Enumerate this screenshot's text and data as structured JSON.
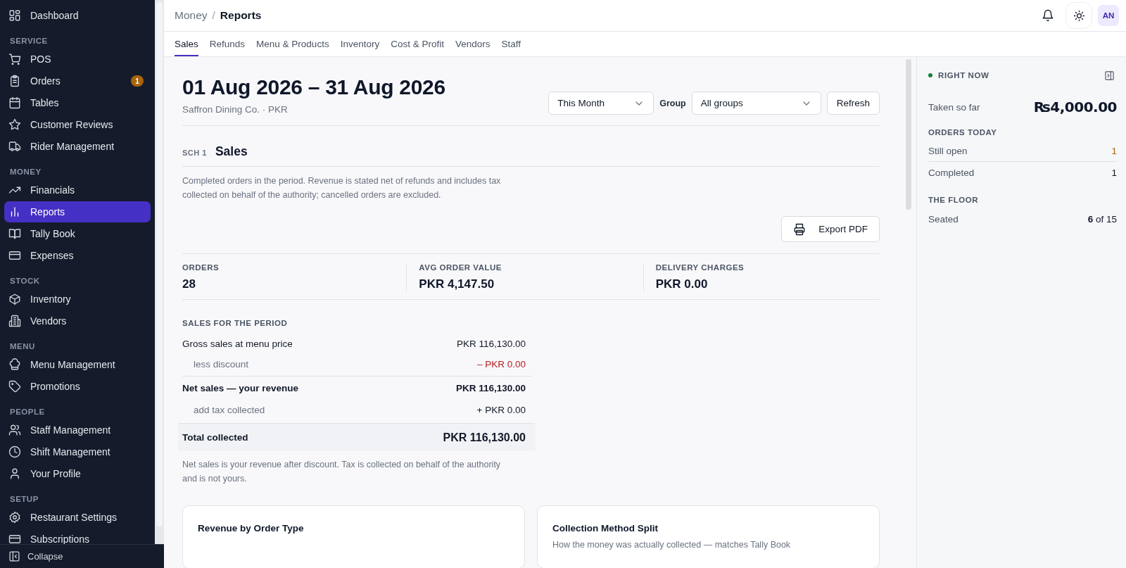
{
  "sidebar": {
    "top_items": [
      {
        "label": "Dashboard",
        "selected": false
      }
    ],
    "sections": [
      {
        "title": "SERVICE",
        "items": [
          {
            "label": "POS",
            "selected": false
          },
          {
            "label": "Orders",
            "selected": false,
            "badge": "1"
          },
          {
            "label": "Tables",
            "selected": false
          },
          {
            "label": "Customer Reviews",
            "selected": false
          },
          {
            "label": "Rider Management",
            "selected": false
          }
        ]
      },
      {
        "title": "MONEY",
        "items": [
          {
            "label": "Financials",
            "selected": false
          },
          {
            "label": "Reports",
            "selected": true
          },
          {
            "label": "Tally Book",
            "selected": false
          },
          {
            "label": "Expenses",
            "selected": false
          }
        ]
      },
      {
        "title": "STOCK",
        "items": [
          {
            "label": "Inventory",
            "selected": false
          },
          {
            "label": "Vendors",
            "selected": false
          }
        ]
      },
      {
        "title": "MENU",
        "items": [
          {
            "label": "Menu Management",
            "selected": false
          },
          {
            "label": "Promotions",
            "selected": false
          }
        ]
      },
      {
        "title": "PEOPLE",
        "items": [
          {
            "label": "Staff Management",
            "selected": false
          },
          {
            "label": "Shift Management",
            "selected": false
          },
          {
            "label": "Your Profile",
            "selected": false
          }
        ]
      },
      {
        "title": "SETUP",
        "items": [
          {
            "label": "Restaurant Settings",
            "selected": false
          },
          {
            "label": "Subscriptions",
            "selected": false
          }
        ]
      }
    ],
    "collapse": "Collapse"
  },
  "breadcrumb": {
    "parent": "Money",
    "separator": "/",
    "current": "Reports"
  },
  "header": {
    "avatar": "AN"
  },
  "tabs": [
    {
      "label": "Sales",
      "selected": true
    },
    {
      "label": "Refunds",
      "selected": false
    },
    {
      "label": "Menu & Products",
      "selected": false
    },
    {
      "label": "Inventory",
      "selected": false
    },
    {
      "label": "Cost & Profit",
      "selected": false
    },
    {
      "label": "Vendors",
      "selected": false
    },
    {
      "label": "Staff",
      "selected": false
    }
  ],
  "report": {
    "title": "01 Aug 2026 – 31 Aug 2026",
    "subtitle": "Saffron Dining Co. · PKR",
    "period": "This Month",
    "group_label": "Group",
    "group": "All groups",
    "refresh": "Refresh",
    "section": {
      "code": "SCH 1",
      "title": "Sales",
      "description": "Completed orders in the period. Revenue is stated net of refunds and includes tax collected on behalf of the authority; cancelled orders are excluded.",
      "export": "Export PDF"
    },
    "kpis": [
      {
        "label": "ORDERS",
        "value": "28"
      },
      {
        "label": "AVG ORDER VALUE",
        "value": "PKR 4,147.50"
      },
      {
        "label": "DELIVERY CHARGES",
        "value": "PKR 0.00"
      }
    ],
    "sales_title": "SALES FOR THE PERIOD",
    "lines": [
      {
        "kind": "main",
        "label": "Gross sales at menu price",
        "value": "PKR 116,130.00"
      },
      {
        "kind": "deduction",
        "label": "less discount",
        "value": "– PKR 0.00"
      },
      {
        "kind": "subtotal",
        "label": "Net sales — your revenue",
        "value": "PKR 116,130.00"
      },
      {
        "kind": "addition",
        "label": "add tax collected",
        "value": "+ PKR 0.00"
      },
      {
        "kind": "total",
        "label": "Total collected",
        "value": "PKR 116,130.00"
      }
    ],
    "note": "Net sales is your revenue after discount. Tax is collected on behalf of the authority and is not yours.",
    "cards": [
      {
        "title": "Revenue by Order Type"
      },
      {
        "title": "Collection Method Split",
        "subtitle": "How the money was actually collected — matches Tally Book"
      }
    ]
  },
  "right_now": {
    "title": "RIGHT NOW",
    "taken_label": "Taken so far",
    "taken_value": "₨4,000.00",
    "groups": [
      {
        "title": "ORDERS TODAY",
        "rows": [
          {
            "label": "Still open",
            "value": "1",
            "kind": "pending"
          },
          {
            "label": "Completed",
            "value": "1",
            "kind": "plain"
          }
        ]
      },
      {
        "title": "THE FLOOR",
        "rows": [
          {
            "label": "Seated",
            "value": "**6** of 15",
            "kind": "plain"
          }
        ]
      }
    ]
  }
}
